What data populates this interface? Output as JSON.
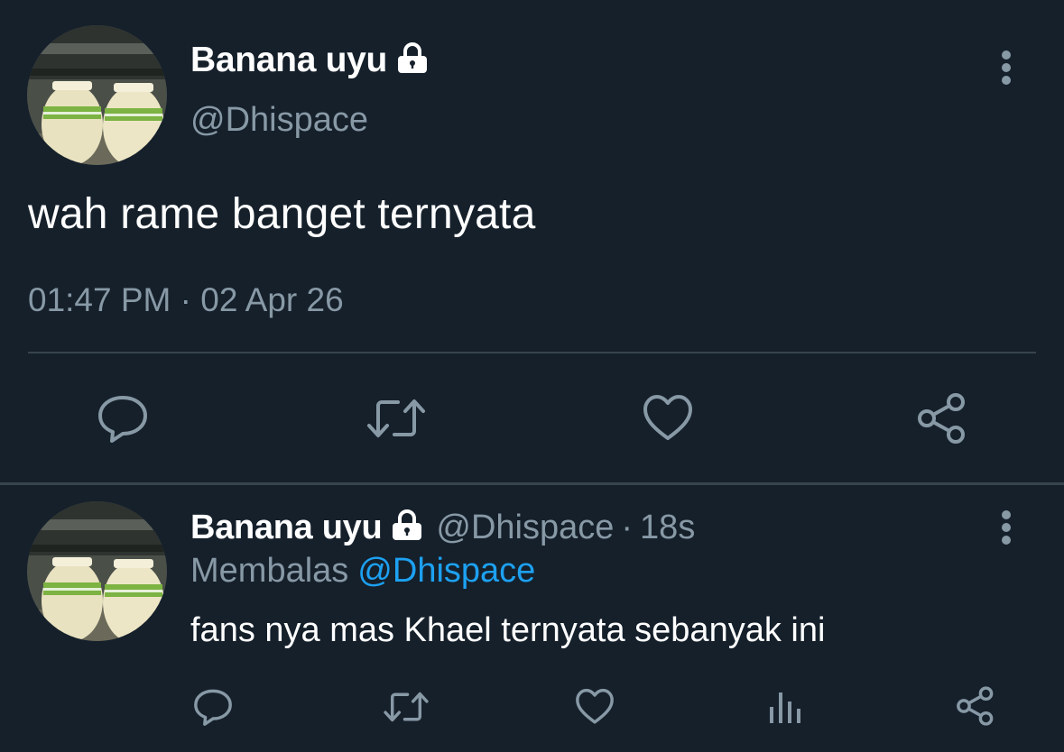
{
  "main_tweet": {
    "display_name": "Banana uyu",
    "handle": "@Dhispace",
    "text": "wah rame banget ternyata",
    "time": "01:47 PM",
    "date_separator": "·",
    "date": "02 Apr 26",
    "icons": [
      "lock-icon",
      "more-vertical-icon",
      "reply-icon",
      "retweet-icon",
      "like-icon",
      "share-icon"
    ]
  },
  "reply_tweet": {
    "display_name": "Banana uyu",
    "handle": "@Dhispace",
    "separator": "·",
    "time_ago": "18s",
    "replying_label": "Membalas",
    "replying_to": "@Dhispace",
    "text": "fans nya mas Khael ternyata sebanyak ini",
    "icons": [
      "lock-icon",
      "more-vertical-icon",
      "reply-icon",
      "retweet-icon",
      "like-icon",
      "stats-icon",
      "share-icon"
    ]
  },
  "colors": {
    "background": "#15202b",
    "primary_text": "#ffffff",
    "secondary_text": "#8899a6",
    "divider": "#38444d",
    "link": "#1da1f2",
    "icon": "#8899a6"
  }
}
